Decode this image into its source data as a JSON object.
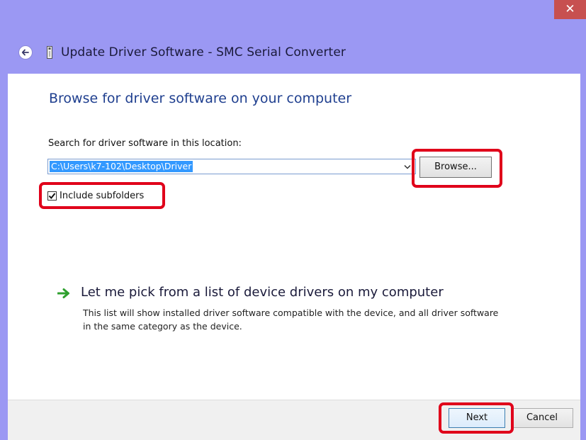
{
  "window": {
    "title": "Update Driver Software - SMC Serial Converter",
    "close_glyph": "✕",
    "titlebar_color": "#9b98f3",
    "close_color": "#c75050"
  },
  "main": {
    "heading": "Browse for driver software on your computer",
    "search_label": "Search for driver software in this location:",
    "path_value": "C:\\Users\\k7-102\\Desktop\\Driver",
    "browse_label": "Browse...",
    "include_subfolders_label": "Include subfolders",
    "include_subfolders_checked": true,
    "pick_title": "Let me pick from a list of device drivers on my computer",
    "pick_description": "This list will show installed driver software compatible with the device, and all driver software in the same category as the device."
  },
  "footer": {
    "next_label": "Next",
    "cancel_label": "Cancel"
  },
  "highlight_color": "#e0001a",
  "icons": [
    "back-arrow-icon",
    "usb-device-icon",
    "chevron-down-icon",
    "checkmark-icon",
    "green-arrow-icon",
    "close-icon"
  ]
}
